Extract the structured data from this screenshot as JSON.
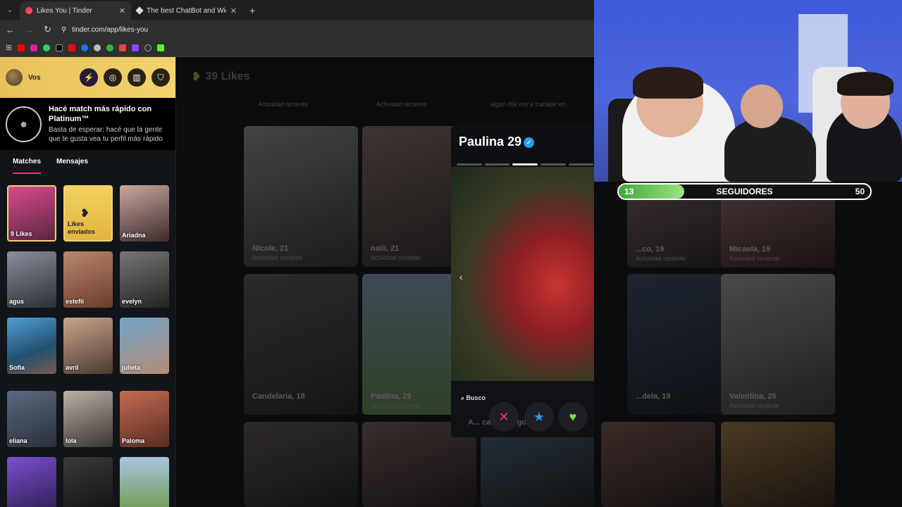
{
  "browser": {
    "tabs": [
      {
        "title": "Likes You | Tinder",
        "active": true
      },
      {
        "title": "The best ChatBot and Widgets",
        "active": false
      }
    ],
    "url": "tinder.com/app/likes-you"
  },
  "sidebar": {
    "user_name": "Vos",
    "promo_title": "Hacé match más rápido con Platinum™",
    "promo_subtitle": "Basta de esperar: hacé que la gente que te gusta vea tu perfil más rápido",
    "tabs": [
      "Matches",
      "Mensajes"
    ],
    "matches": [
      {
        "name": "9 Likes"
      },
      {
        "name": "Likes enviados"
      },
      {
        "name": "Ariadna"
      },
      {
        "name": "agus"
      },
      {
        "name": "estefii"
      },
      {
        "name": "evelyn"
      },
      {
        "name": "Sofia"
      },
      {
        "name": "avril"
      },
      {
        "name": "julieta"
      },
      {
        "name": "eliana"
      },
      {
        "name": "lola"
      },
      {
        "name": "Paloma"
      }
    ]
  },
  "main": {
    "title": "39 Likes",
    "top_sub": [
      "Actividad reciente",
      "Actividad reciente",
      "algún día voy a trabajar en ."
    ],
    "cards": [
      {
        "name": "Nicole, 21",
        "sub": "Actividad reciente"
      },
      {
        "name": "naiii, 21",
        "sub": "Actividad reciente"
      },
      {
        "name": "Candelaria, 18",
        "sub": ""
      },
      {
        "name": "Paulina, 29",
        "sub": "Actividad reciente"
      },
      {
        "name": "...co, 19",
        "sub": "Actividad reciente"
      },
      {
        "name": "Micaela, 19",
        "sub": "Actividad reciente"
      },
      {
        "name": "...dela, 19",
        "sub": "Actividad reciente"
      },
      {
        "name": "Valentina, 20",
        "sub": "Actividad reciente"
      }
    ]
  },
  "profile": {
    "name": "Paulina 29",
    "busco": "Busco",
    "relation": "A... casual, algo ... ole"
  },
  "overlay": {
    "followers": 13,
    "label": "SEGUIDORES",
    "goal": 50
  },
  "colors": {
    "tinder_pink": "#fd267a",
    "gold": "#f3d36c",
    "nope": "#fd267a",
    "superlike": "#2c9bf0",
    "like": "#7ed957"
  }
}
